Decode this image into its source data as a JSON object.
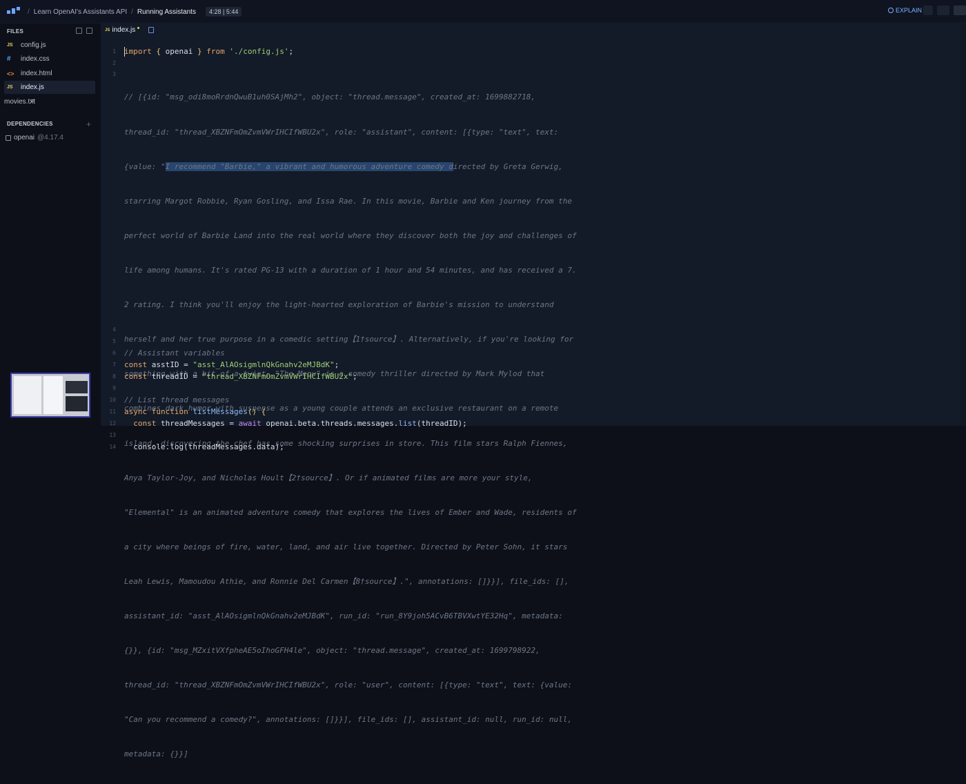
{
  "topbar": {
    "breadcrumb": [
      "Learn OpenAI's Assistants API",
      "Running Assistants"
    ],
    "time": "4:28",
    "duration": "5:44",
    "explain_label": "EXPLAIN"
  },
  "sidebar": {
    "files_heading": "FILES",
    "files": [
      {
        "name": "config.js",
        "type": "js",
        "icon": "JS"
      },
      {
        "name": "index.css",
        "type": "css",
        "icon": "#"
      },
      {
        "name": "index.html",
        "type": "html",
        "icon": "<>"
      },
      {
        "name": "index.js",
        "type": "js",
        "icon": "JS",
        "active": true
      },
      {
        "name": "movies.txt",
        "type": "txt",
        "icon": "≡"
      }
    ],
    "dependencies_heading": "DEPENDENCIES",
    "dependency": {
      "name": "openai",
      "version": "@4.17.4"
    }
  },
  "editor": {
    "tab_label": "index.js",
    "tab_icon": "JS",
    "lines": {
      "n1": "1",
      "n2": "2",
      "n3": "3",
      "n4": "4",
      "n5": "5",
      "n6": "6",
      "n7": "7",
      "n8": "8",
      "n9": "9",
      "n10": "10",
      "n11": "11",
      "n12": "12",
      "n13": "13",
      "n14": "14",
      "l1_kw": "import",
      "l1_a": " { ",
      "l1_id": "openai",
      "l1_b": " } ",
      "l1_from": "from",
      "l1_str": " './config.js'",
      "l1_end": ";",
      "c1": "// [{id: \"msg_odi8moRrdnQwuB1uh0SAjMh2\", object: \"thread.message\", created_at: 1699882718,",
      "c2": "thread_id: \"thread_XBZNFmOmZvmVWrIHCIfWBU2x\", role: \"assistant\", content: [{type: \"text\", text:",
      "c3a": "{value: \"",
      "c3sel": "I recommend \"Barbie,\" a vibrant and humorous adventure comedy d",
      "c3b": "irected by Greta Gerwig,",
      "c4": "starring Margot Robbie, Ryan Gosling, and Issa Rae. In this movie, Barbie and Ken journey from the",
      "c5": "perfect world of Barbie Land into the real world where they discover both the joy and challenges of",
      "c6": "life among humans. It's rated PG-13 with a duration of 1 hour and 54 minutes, and has received a 7.",
      "c7": "2 rating. I think you'll enjoy the light-hearted exploration of Barbie's mission to understand",
      "c8": "herself and her true purpose in a comedic setting【1†source】. Alternatively, if you're looking for",
      "c9": "something with a bit of a twist, \"The Menu\" is a comedy thriller directed by Mark Mylod that",
      "c10": "combines dark humor with suspense as a young couple attends an exclusive restaurant on a remote",
      "c11": "island, discovering the chef has some shocking surprises in store. This film stars Ralph Fiennes,",
      "c12": "Anya Taylor-Joy, and Nicholas Hoult【2†source】. Or if animated films are more your style,",
      "c13": "\"Elemental\" is an animated adventure comedy that explores the lives of Ember and Wade, residents of",
      "c14": "a city where beings of fire, water, land, and air live together. Directed by Peter Sohn, it stars",
      "c15": "Leah Lewis, Mamoudou Athie, and Ronnie Del Carmen【8†source】.\", annotations: []}}], file_ids: [],",
      "c16": "assistant_id: \"asst_AlAOsigmlnQkGnahv2eMJBdK\", run_id: \"run_8Y9joh5ACvB6TBVXwtYE32Hq\", metadata:",
      "c17": "{}}, {id: \"msg_MZxitVXfpheAE5oIhoGFH4le\", object: \"thread.message\", created_at: 1699798922,",
      "c18": "thread_id: \"thread_XBZNFmOmZvmVWrIHCIfWBU2x\", role: \"user\", content: [{type: \"text\", text: {value:",
      "c19": "\"Can you recommend a comedy?\", annotations: []}}], file_ids: [], assistant_id: null, run_id: null,",
      "c20": "metadata: {}}]",
      "l6": "// Assistant variables",
      "l7_kw": "const",
      "l7_id": " asstID = ",
      "l7_str": "\"asst_AlAOsigmlnQkGnahv2eMJBdK\"",
      "l7_end": ";",
      "l8_kw": "const",
      "l8_id": " threadID = ",
      "l8_str": "\"thread_XBZNFmOmZvmVWrIHCIfWBU2x\"",
      "l8_end": ";",
      "l10": "// List thread messages",
      "l11_kw": "async function",
      "l11_fn": " listMessages",
      "l11_p": "()",
      "l11_b": " {",
      "l12_kw": "  const",
      "l12_id": " threadMessages = ",
      "l12_aw": "await",
      "l12_call": " openai.beta.threads.messages.",
      "l12_fn": "list",
      "l12_args": "(threadID);",
      "l14": "  console.log(threadMessages.data);"
    }
  }
}
